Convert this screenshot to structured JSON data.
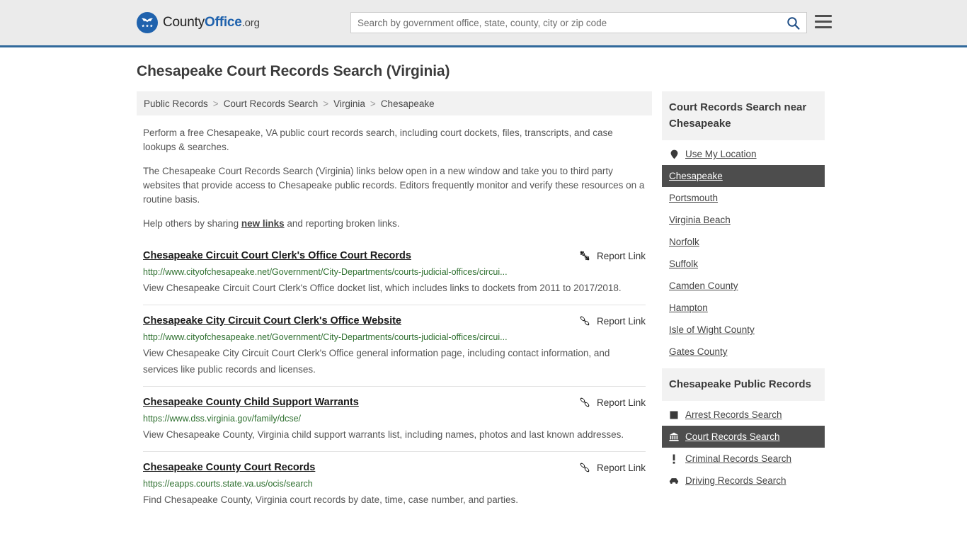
{
  "header": {
    "brand_pre": "County",
    "brand_bold": "Office",
    "brand_tld": ".org",
    "search_placeholder": "Search by government office, state, county, city or zip code",
    "search_value": "",
    "search_icon": "search-icon",
    "menu_icon": "hamburger-menu-icon",
    "accent_color": "#31699b",
    "brand_color": "#1f62ad"
  },
  "page": {
    "title": "Chesapeake Court Records Search (Virginia)"
  },
  "breadcrumb": {
    "separator": ">",
    "items": [
      {
        "label": "Public Records"
      },
      {
        "label": "Court Records Search"
      },
      {
        "label": "Virginia"
      },
      {
        "label": "Chesapeake"
      }
    ]
  },
  "intro": {
    "p1": "Perform a free Chesapeake, VA public court records search, including court dockets, files, transcripts, and case lookups & searches.",
    "p2": "The Chesapeake Court Records Search (Virginia) links below open in a new window and take you to third party websites that provide access to Chesapeake public records. Editors frequently monitor and verify these resources on a routine basis.",
    "p3_before": "Help others by sharing ",
    "p3_link": "new links",
    "p3_after": " and reporting broken links."
  },
  "results": {
    "report_label": "Report Link",
    "report_icon": "broken-link-icon",
    "url_color": "#2f7030",
    "items": [
      {
        "title": "Chesapeake Circuit Court Clerk's Office Court Records",
        "url": "http://www.cityofchesapeake.net/Government/City-Departments/courts-judicial-offices/circui...",
        "description": "View Chesapeake Circuit Court Clerk's Office docket list, which includes links to dockets from 2011 to 2017/2018."
      },
      {
        "title": "Chesapeake City Circuit Court Clerk's Office Website",
        "url": "http://www.cityofchesapeake.net/Government/City-Departments/courts-judicial-offices/circui...",
        "description": "View Chesapeake City Circuit Court Clerk's Office general information page, including contact information, and services like public records and licenses."
      },
      {
        "title": "Chesapeake County Child Support Warrants",
        "url": "https://www.dss.virginia.gov/family/dcse/",
        "description": "View Chesapeake County, Virginia child support warrants list, including names, photos and last known addresses."
      },
      {
        "title": "Chesapeake County Court Records",
        "url": "https://eapps.courts.state.va.us/ocis/search",
        "description": "Find Chesapeake County, Virginia court records by date, time, case number, and parties."
      }
    ]
  },
  "sidebar": {
    "nearby": {
      "heading": "Court Records Search near Chesapeake",
      "items": [
        {
          "label": "Use My Location",
          "icon": "map-pin-icon",
          "active": false
        },
        {
          "label": "Chesapeake",
          "icon": "",
          "active": true
        },
        {
          "label": "Portsmouth",
          "icon": "",
          "active": false
        },
        {
          "label": "Virginia Beach",
          "icon": "",
          "active": false
        },
        {
          "label": "Norfolk",
          "icon": "",
          "active": false
        },
        {
          "label": "Suffolk",
          "icon": "",
          "active": false
        },
        {
          "label": "Camden County",
          "icon": "",
          "active": false
        },
        {
          "label": "Hampton",
          "icon": "",
          "active": false
        },
        {
          "label": "Isle of Wight County",
          "icon": "",
          "active": false
        },
        {
          "label": "Gates County",
          "icon": "",
          "active": false
        }
      ]
    },
    "public_records": {
      "heading": "Chesapeake Public Records",
      "items": [
        {
          "label": "Arrest Records Search",
          "icon": "square-icon",
          "active": false
        },
        {
          "label": "Court Records Search",
          "icon": "courthouse-icon",
          "active": true
        },
        {
          "label": "Criminal Records Search",
          "icon": "exclamation-icon",
          "active": false
        },
        {
          "label": "Driving Records Search",
          "icon": "car-icon",
          "active": false
        }
      ]
    },
    "active_bg": "#4d4d4d"
  }
}
